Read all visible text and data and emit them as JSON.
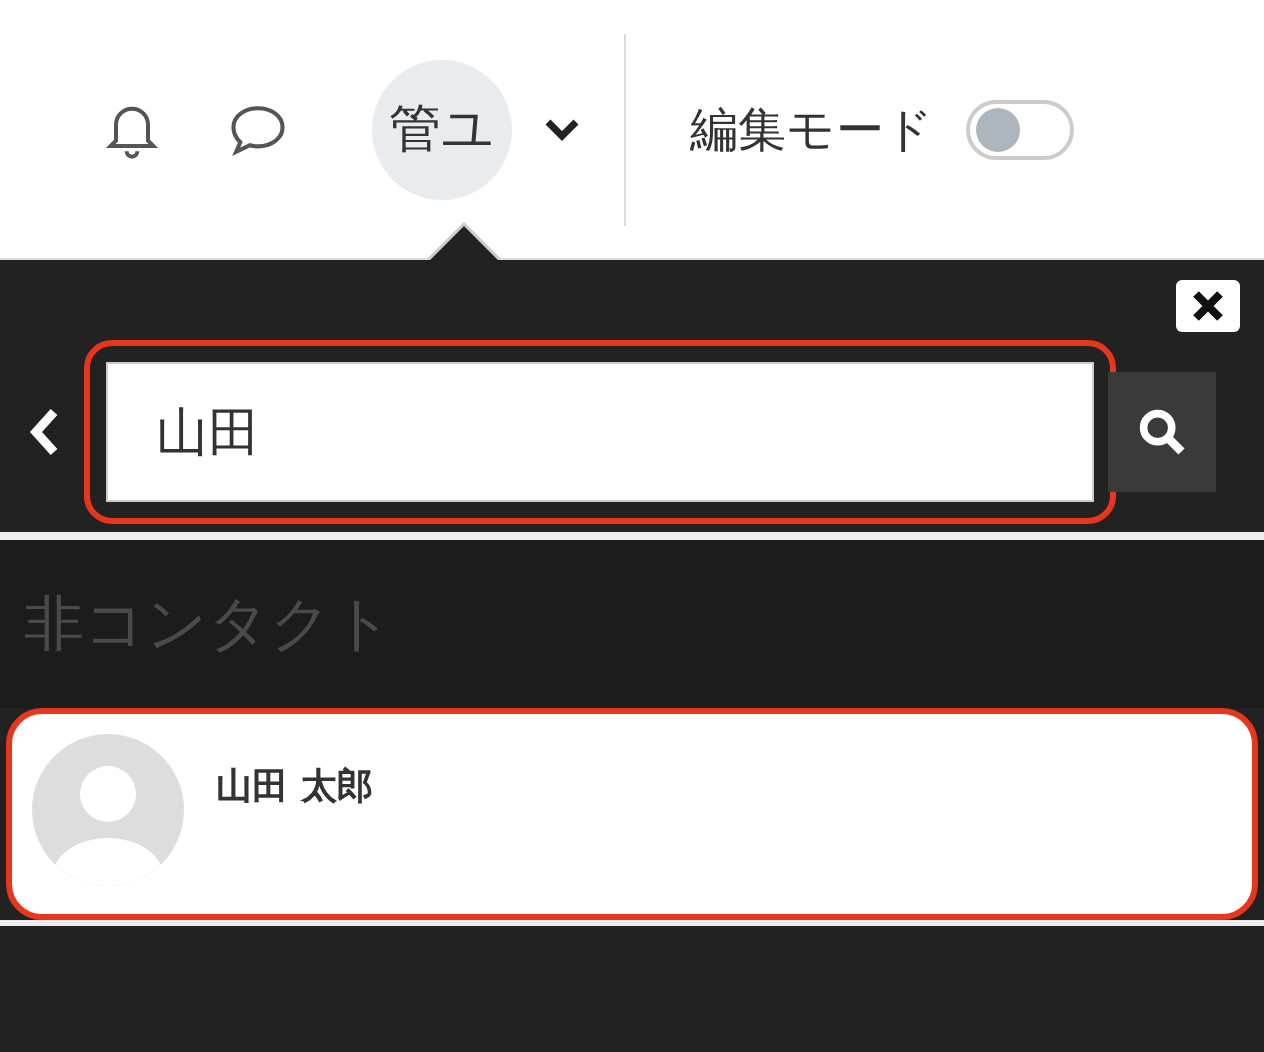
{
  "navbar": {
    "user_initials": "管ユ",
    "edit_mode": {
      "label": "編集モード",
      "on": false
    }
  },
  "drawer": {
    "search": {
      "value": "山田",
      "highlighted": true
    },
    "section": "非コンタクト",
    "contacts": [
      {
        "name": "山田 太郎",
        "highlighted": true
      }
    ]
  }
}
